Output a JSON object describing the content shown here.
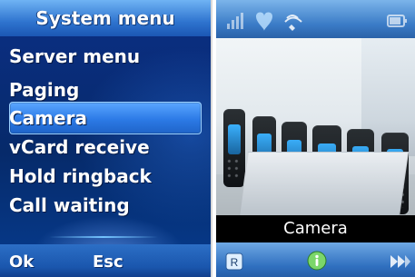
{
  "left_screen": {
    "title": "System menu",
    "menu_items": [
      "Server menu",
      "Paging",
      "Camera",
      "vCard receive",
      "Hold ringback",
      "Call waiting"
    ],
    "selected_index": 2,
    "softkeys": {
      "left": "Ok",
      "right": "Esc"
    }
  },
  "right_screen": {
    "caption": "Camera",
    "softkeys": {
      "left": "R"
    },
    "icons": [
      "signal-icon",
      "heart-icon",
      "call-icon",
      "battery-icon",
      "info-icon",
      "forward-icon"
    ]
  }
}
